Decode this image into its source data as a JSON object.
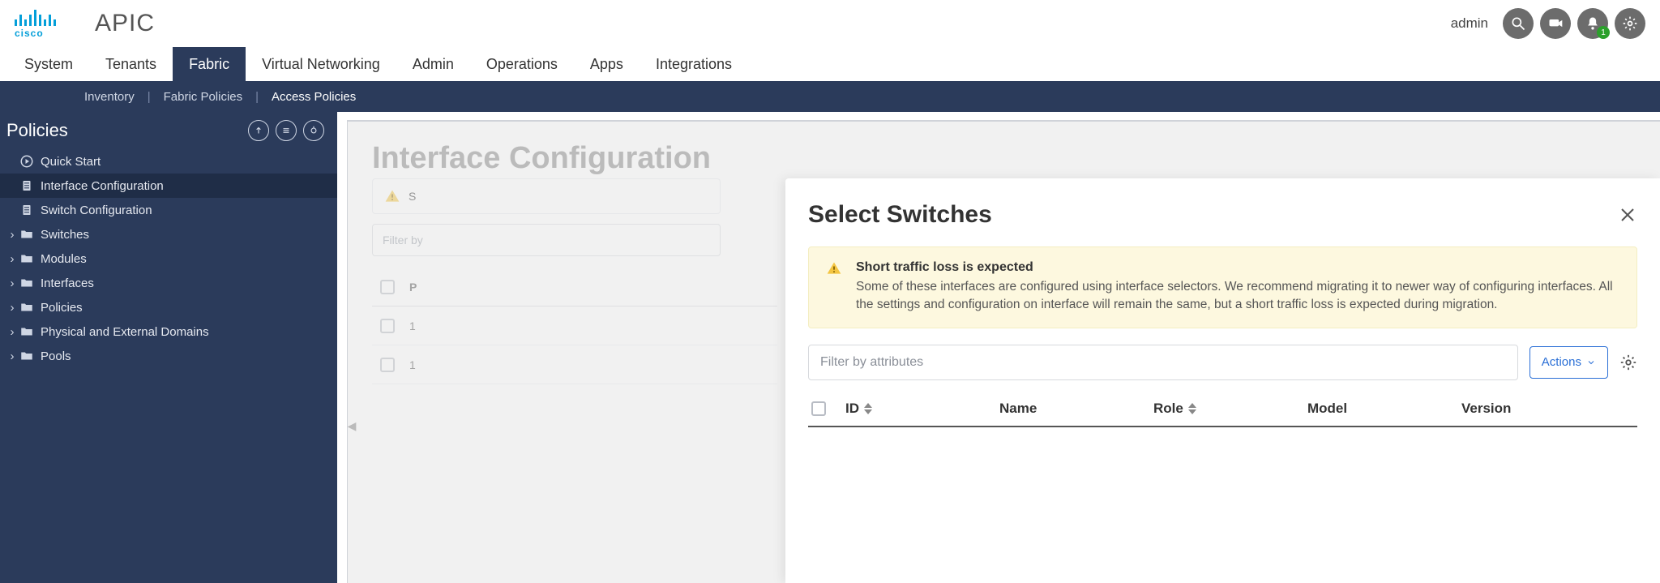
{
  "brand": {
    "vendor_word": "cisco",
    "app": "APIC"
  },
  "user": {
    "name": "admin",
    "notif_badge": "1"
  },
  "menu": {
    "items": [
      "System",
      "Tenants",
      "Fabric",
      "Virtual Networking",
      "Admin",
      "Operations",
      "Apps",
      "Integrations"
    ],
    "active": "Fabric"
  },
  "submenu": {
    "items": [
      "Inventory",
      "Fabric Policies",
      "Access Policies"
    ],
    "active": "Access Policies"
  },
  "sidebar": {
    "title": "Policies",
    "nodes": [
      {
        "label": "Quick Start",
        "icon": "play",
        "expandable": false
      },
      {
        "label": "Interface Configuration",
        "icon": "doc",
        "expandable": false,
        "selected": true
      },
      {
        "label": "Switch Configuration",
        "icon": "doc",
        "expandable": false
      },
      {
        "label": "Switches",
        "icon": "folder",
        "expandable": true
      },
      {
        "label": "Modules",
        "icon": "folder",
        "expandable": true
      },
      {
        "label": "Interfaces",
        "icon": "folder",
        "expandable": true
      },
      {
        "label": "Policies",
        "icon": "folder",
        "expandable": true
      },
      {
        "label": "Physical and External Domains",
        "icon": "folder",
        "expandable": true
      },
      {
        "label": "Pools",
        "icon": "folder",
        "expandable": true
      }
    ]
  },
  "page": {
    "title": "Interface Configuration",
    "bg_filter_placeholder": "Filter by",
    "bg_col_header": "P",
    "bg_rows": [
      "1",
      "1"
    ]
  },
  "modal": {
    "title": "Select Switches",
    "alert_title": "Short traffic loss is expected",
    "alert_body": "Some of these interfaces are configured using interface selectors. We recommend migrating it to newer way of configuring interfaces. All the settings and configuration on interface will remain the same, but a short traffic loss is expected during migration.",
    "filter_placeholder": "Filter by attributes",
    "actions_label": "Actions",
    "columns": [
      "ID",
      "Name",
      "Role",
      "Model",
      "Version"
    ]
  }
}
